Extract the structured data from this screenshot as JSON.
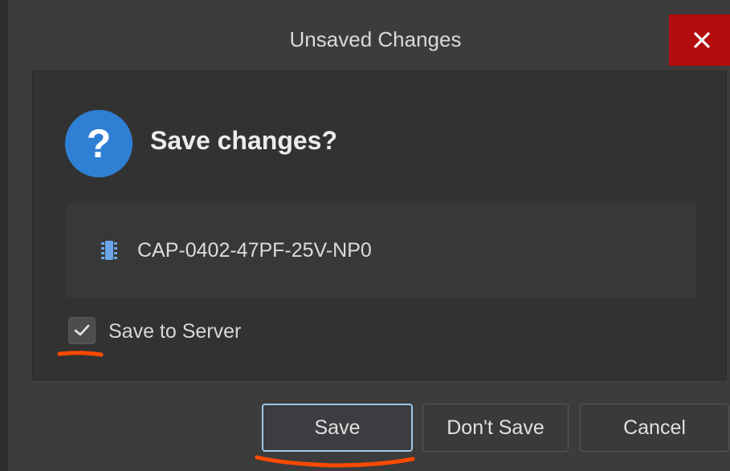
{
  "dialog": {
    "title": "Unsaved Changes",
    "close_label": "✕",
    "heading": "Save changes?",
    "question_glyph": "?",
    "item_name": "CAP-0402-47PF-25V-NP0",
    "item_icon": "component-chip-icon",
    "save_to_server_label": "Save to Server",
    "save_to_server_checked": true
  },
  "buttons": {
    "save": "Save",
    "dont_save": "Don't Save",
    "cancel": "Cancel"
  },
  "colors": {
    "close_bg": "#b30c0c",
    "question_icon": "#2f7fd4",
    "chip_icon": "#6aa6e8",
    "annotation": "#ff4a00"
  }
}
